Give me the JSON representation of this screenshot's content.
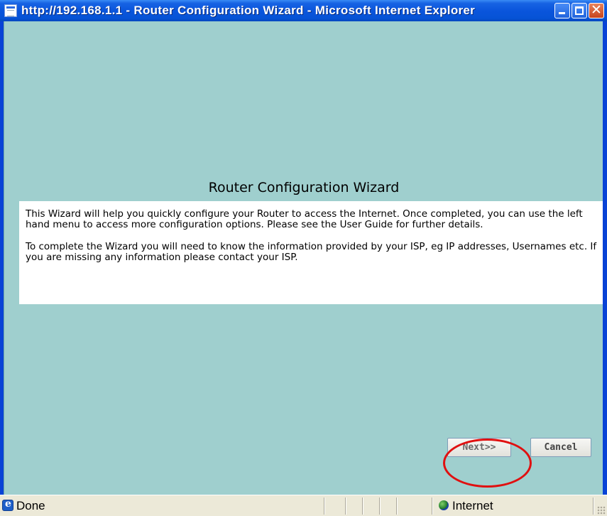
{
  "window": {
    "title": "http://192.168.1.1 - Router Configuration Wizard - Microsoft Internet Explorer",
    "title_icon": "ie-page-icon",
    "controls": [
      "minimize-icon",
      "maximize-icon",
      "close-icon"
    ],
    "close_glyph": "✕"
  },
  "main": {
    "heading": "Router Configuration Wizard",
    "paragraphs": [
      "This Wizard will help you quickly configure your Router to access the Internet. Once completed, you can use the left hand menu to access more configuration options. Please see the User Guide for further details.",
      "To complete the Wizard you will need to know the information provided by your ISP, eg IP addresses, Usernames etc. If you are missing any information please contact your ISP."
    ],
    "background_color": "#9fcfce"
  },
  "buttons": {
    "next_label": "Next>>",
    "cancel_label": "Cancel"
  },
  "annotation": {
    "highlight_color": "#e01010",
    "target": "next-button"
  },
  "status_bar": {
    "status_text": "Done",
    "zone_text": "Internet",
    "status_icon": "ie-logo-icon",
    "zone_icon": "globe-icon"
  }
}
